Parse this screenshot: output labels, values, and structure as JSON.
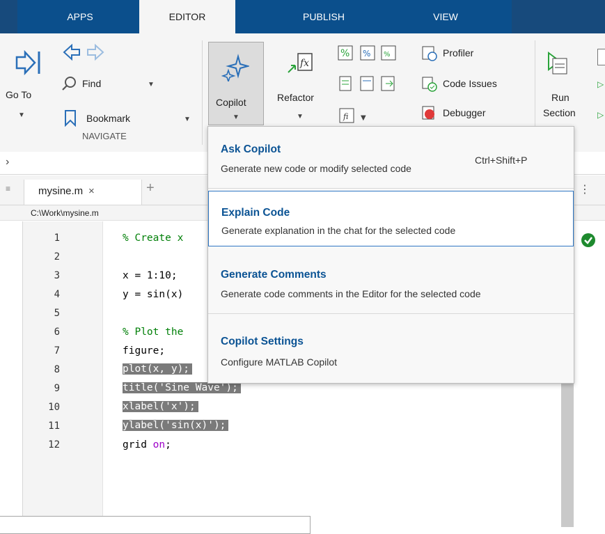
{
  "tabs": [
    {
      "label": "APPS"
    },
    {
      "label": "EDITOR"
    },
    {
      "label": "PUBLISH"
    },
    {
      "label": "VIEW"
    }
  ],
  "ribbon": {
    "go_to": "Go To",
    "find": "Find",
    "bookmark": "Bookmark",
    "navigate_group": "NAVIGATE",
    "copilot": "Copilot",
    "refactor": "Refactor",
    "profiler": "Profiler",
    "code_issues": "Code Issues",
    "debugger": "Debugger",
    "run": "Run",
    "section": "Section"
  },
  "address": {
    "chevron": "›"
  },
  "editor": {
    "file_tab": "mysine.m",
    "path": "C:\\Work\\mysine.m",
    "lines": [
      {
        "n": "1",
        "code": "% Create x"
      },
      {
        "n": "2",
        "code": ""
      },
      {
        "n": "3",
        "code": "x = 1:10;"
      },
      {
        "n": "4",
        "code": "y = sin(x)"
      },
      {
        "n": "5",
        "code": ""
      },
      {
        "n": "6",
        "code": "% Plot the"
      },
      {
        "n": "7",
        "code": "figure;"
      },
      {
        "n": "8",
        "code": "plot(x, y);"
      },
      {
        "n": "9",
        "code": "title('Sine Wave');"
      },
      {
        "n": "10",
        "code": "xlabel('x');"
      },
      {
        "n": "11",
        "code": "ylabel('sin(x)');"
      },
      {
        "n": "12",
        "code_a": "grid ",
        "code_b": "on",
        "code_c": ";"
      }
    ]
  },
  "menu": {
    "items": [
      {
        "title": "Ask Copilot",
        "desc": "Generate new code or modify selected code",
        "shortcut": "Ctrl+Shift+P"
      },
      {
        "title": "Explain Code",
        "desc": "Generate explanation in the chat for the selected code"
      },
      {
        "title": "Generate Comments",
        "desc": "Generate code comments in the Editor for the selected code"
      },
      {
        "title": "Copilot Settings",
        "desc": "Configure MATLAB Copilot"
      }
    ]
  },
  "colors": {
    "accent": "#0b4f8c",
    "link": "#0b5394",
    "ok": "#1e8a2e",
    "selection": "#7a7a7a"
  }
}
